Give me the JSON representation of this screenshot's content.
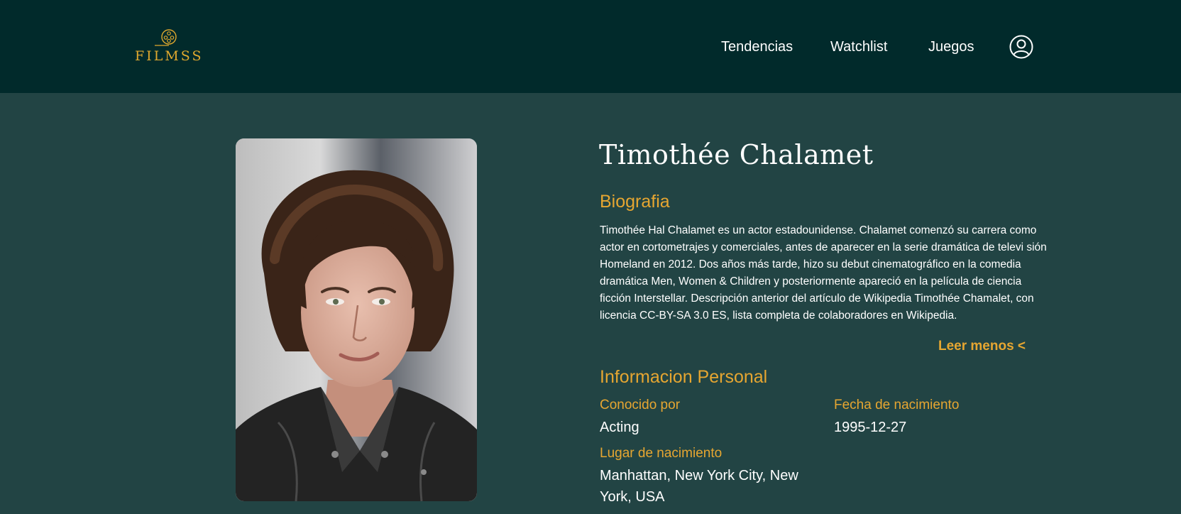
{
  "brand": {
    "logo_text": "FILMSS",
    "accent": "#e0a82e",
    "icon": "film-reel-icon"
  },
  "nav": {
    "items": [
      {
        "label": "Tendencias"
      },
      {
        "label": "Watchlist"
      },
      {
        "label": "Juegos"
      }
    ],
    "user_icon": "user-circle-icon"
  },
  "person": {
    "name": "Timothée Chalamet",
    "photo_icon": "portrait-photo"
  },
  "biography": {
    "title": "Biografia",
    "text": "Timothée Hal Chalamet es un actor estadounidense. Chalamet comenzó su carrera como actor en cortometrajes y comerciales, antes de aparecer en la serie dramática de televi sión Homeland en 2012. Dos años más tarde, hizo su debut cinematográfico en la comedia dramática Men, Women & Children y posteriormente apareció en la película de ciencia ficción Interstellar. Descripción anterior del artículo de Wikipedia Timothée Chamalet, con licencia CC-BY-SA 3.0 ES, lista completa de colaboradores en Wikipedia.",
    "toggle_label": "Leer menos <"
  },
  "personal_info": {
    "title": "Informacion Personal",
    "known_for_label": "Conocido por",
    "known_for_value": "Acting",
    "birthdate_label": "Fecha de nacimiento",
    "birthdate_value": "1995-12-27",
    "birthplace_label": "Lugar de nacimiento",
    "birthplace_value": "Manhattan, New York City, New York, USA"
  },
  "colors": {
    "header_bg": "#012a2b",
    "page_bg": "#224444",
    "accent": "#e6a631",
    "text": "#ffffff"
  }
}
